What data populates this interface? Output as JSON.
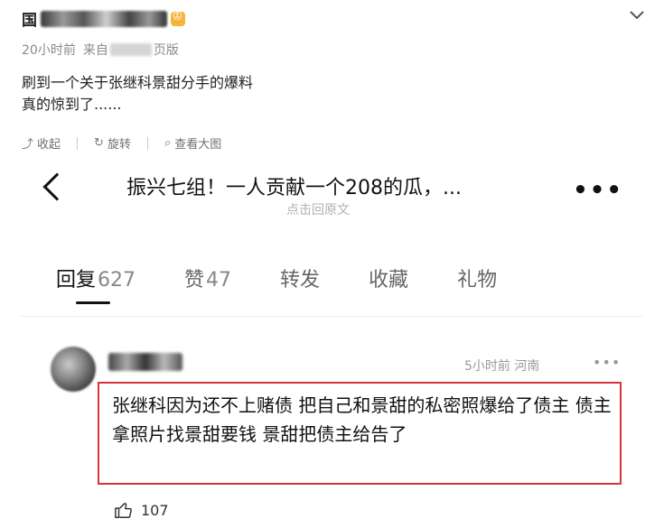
{
  "post": {
    "author_suffix": "",
    "time": "20小时前",
    "source_prefix": "来自",
    "source_suffix": "页版",
    "text_line1": "刷到一个关于张继科景甜分手的爆料",
    "text_line2": "真的惊到了......"
  },
  "tools": {
    "collapse": "收起",
    "rotate": "旋转",
    "view_large": "查看大图"
  },
  "screenshot": {
    "title": "振兴七组！一人贡献一个208的瓜，...",
    "subtitle": "点击回原文",
    "tabs": [
      {
        "label": "回复",
        "count": "627"
      },
      {
        "label": "赞",
        "count": "47"
      },
      {
        "label": "转发",
        "count": ""
      },
      {
        "label": "收藏",
        "count": ""
      },
      {
        "label": "礼物",
        "count": ""
      }
    ],
    "comment": {
      "time_location": "5小时前 河南",
      "text": "张继科因为还不上赌债 把自己和景甜的私密照爆给了债主 债主拿照片找景甜要钱 景甜把债主给告了",
      "likes": "107"
    }
  },
  "icons": {
    "chevron": "chevron-down-icon",
    "back": "back-arrow-icon",
    "more": "more-dots-icon",
    "thumb": "thumbs-up-icon"
  },
  "colors": {
    "highlight_border": "#d8323c",
    "badge": "#f4b63a"
  }
}
